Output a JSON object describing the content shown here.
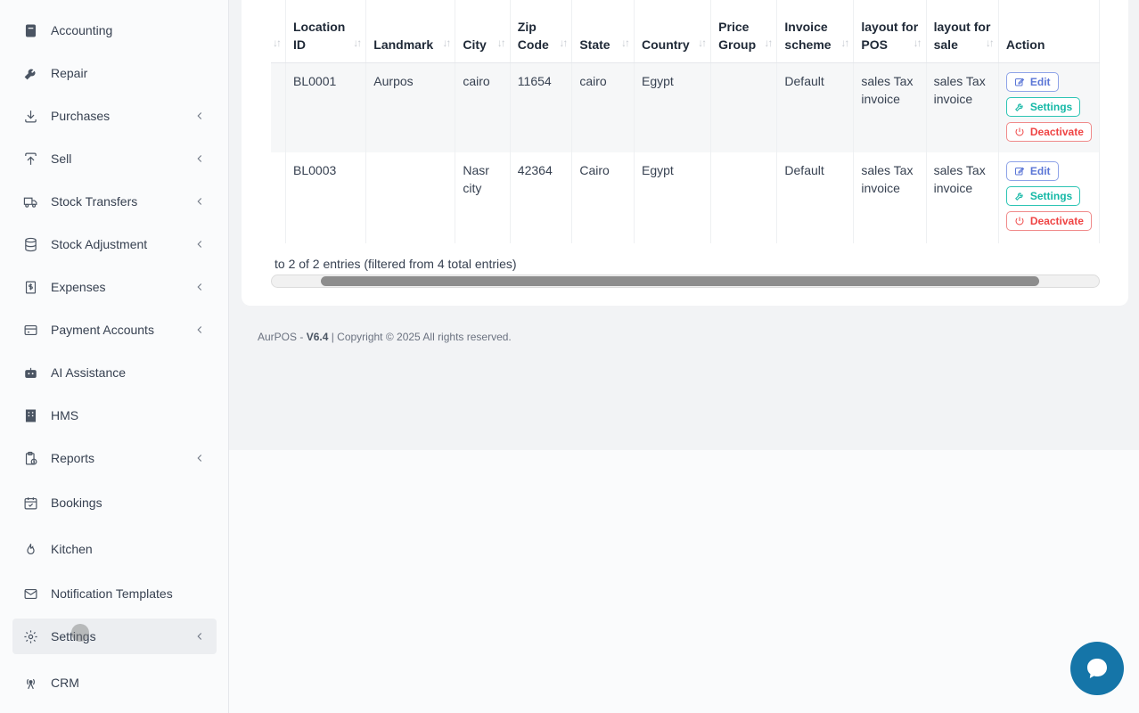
{
  "sidebar": {
    "items": [
      {
        "label": "Accounting",
        "icon": "book-icon",
        "chevron": false
      },
      {
        "label": "Repair",
        "icon": "wrench-icon",
        "chevron": false
      },
      {
        "label": "Purchases",
        "icon": "download-icon",
        "chevron": true
      },
      {
        "label": "Sell",
        "icon": "upload-icon",
        "chevron": true
      },
      {
        "label": "Stock Transfers",
        "icon": "truck-icon",
        "chevron": true
      },
      {
        "label": "Stock Adjustment",
        "icon": "database-icon",
        "chevron": true
      },
      {
        "label": "Expenses",
        "icon": "dollar-file-icon",
        "chevron": true
      },
      {
        "label": "Payment Accounts",
        "icon": "credit-card-icon",
        "chevron": true
      },
      {
        "label": "AI Assistance",
        "icon": "robot-icon",
        "chevron": false
      },
      {
        "label": "HMS",
        "icon": "building-icon",
        "chevron": false
      },
      {
        "label": "Reports",
        "icon": "clipboard-clock-icon",
        "chevron": true
      },
      {
        "label": "Bookings",
        "icon": "calendar-check-icon",
        "chevron": false
      },
      {
        "label": "Kitchen",
        "icon": "flame-icon",
        "chevron": false
      },
      {
        "label": "Notification Templates",
        "icon": "envelope-icon",
        "chevron": false
      },
      {
        "label": "Settings",
        "icon": "gear-icon",
        "chevron": true,
        "active": true
      },
      {
        "label": "CRM",
        "icon": "broadcast-icon",
        "chevron": false
      }
    ]
  },
  "table": {
    "headers": [
      {
        "label": "",
        "key": "hidden"
      },
      {
        "label": "Location ID",
        "key": "location_id"
      },
      {
        "label": "Landmark",
        "key": "landmark"
      },
      {
        "label": "City",
        "key": "city"
      },
      {
        "label": "Zip Code",
        "key": "zip"
      },
      {
        "label": "State",
        "key": "state"
      },
      {
        "label": "Country",
        "key": "country"
      },
      {
        "label": "Price Group",
        "key": "price_group"
      },
      {
        "label": "Invoice scheme",
        "key": "invoice_scheme"
      },
      {
        "label": "layout for POS",
        "key": "layout_pos"
      },
      {
        "label": "layout for sale",
        "key": "layout_sale"
      },
      {
        "label": "Action",
        "key": "action"
      }
    ],
    "rows": [
      {
        "location_id": "BL0001",
        "landmark": "Aurpos",
        "city": "cairo",
        "zip": "11654",
        "state": "cairo",
        "country": "Egypt",
        "price_group": "",
        "invoice_scheme": "Default",
        "layout_pos": "sales Tax invoice",
        "layout_sale": "sales Tax invoice"
      },
      {
        "location_id": "BL0003",
        "landmark": "",
        "city": "Nasr city",
        "zip": "42364",
        "state": "Cairo",
        "country": "Egypt",
        "price_group": "",
        "invoice_scheme": "Default",
        "layout_pos": "sales Tax invoice",
        "layout_sale": "sales Tax invoice"
      }
    ],
    "actions": {
      "edit": "Edit",
      "settings": "Settings",
      "deactivate": "Deactivate"
    }
  },
  "entries_text": "to 2 of 2 entries (filtered from 4 total entries)",
  "footer": {
    "brand": "AurPOS - ",
    "version": "V6.4",
    "copyright": " | Copyright © 2025 All rights reserved."
  },
  "colors": {
    "chat_button": "#1575a8",
    "edit": "#5b76d6",
    "settings": "#14b8a6",
    "deactivate": "#ef4444"
  }
}
